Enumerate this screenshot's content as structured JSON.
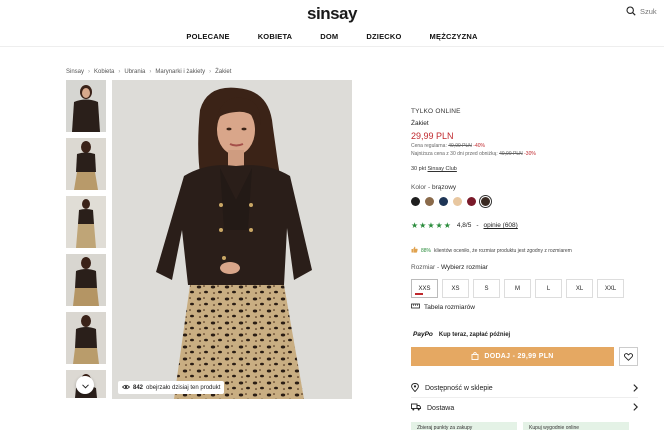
{
  "header": {
    "logo": "sinsay",
    "search_placeholder": "Szuk",
    "nav": [
      "POLECANE",
      "KOBIETA",
      "DOM",
      "DZIECKO",
      "MĘŻCZYZNA"
    ]
  },
  "breadcrumb": [
    "Sinsay",
    "Kobieta",
    "Ubrania",
    "Marynarki i żakiety",
    "Żakiet"
  ],
  "gallery": {
    "viewers_count": "842",
    "viewers_text": "obejrzało dzisiaj ten produkt"
  },
  "product": {
    "badge": "TYLKO ONLINE",
    "name": "Żakiet",
    "price": "29,99 PLN",
    "regular_label": "Cena regularna:",
    "regular_price": "49,99 PLN",
    "regular_discount": "-40%",
    "lowest_label": "Najniższa cena z 30 dni przed obniżką:",
    "lowest_price": "49,99 PLN",
    "lowest_discount": "-30%",
    "club_points": "30 pkt",
    "club_name": "Sinsay Club",
    "color_label": "Kolor -",
    "color_value": "brązowy",
    "swatches": [
      "#1f1f1f",
      "#8a6a4a",
      "#1e3556",
      "#e8c7a0",
      "#7a1a2a",
      "#3a2a22"
    ],
    "rating_stars": "★★★★★",
    "rating_value": "4,8/5",
    "rating_sep": "-",
    "rating_opinions": "opinie (608)",
    "fit_percent": "88%",
    "fit_text": "klientów oceniło, że rozmiar produktu jest zgodny z rozmiarem",
    "size_label": "Rozmiar -",
    "size_value": "Wybierz rozmiar",
    "sizes": [
      "XXS",
      "XS",
      "S",
      "M",
      "L",
      "XL",
      "XXL"
    ],
    "size_table": "Tabela rozmiarów",
    "paypo_logo": "PayPo",
    "paypo_text": "Kup teraz, zapłać później",
    "add_to_cart": "DODAJ - 29,99 PLN",
    "availability": "Dostępność w sklepie",
    "delivery": "Dostawa",
    "box1": "Zbieraj punkty za zakupy",
    "box2": "Kupuj wygodnie online"
  },
  "colors": {
    "accent_orange": "#e5a862",
    "sale_red": "#c0282d",
    "rating_green": "#2a8c3c"
  }
}
